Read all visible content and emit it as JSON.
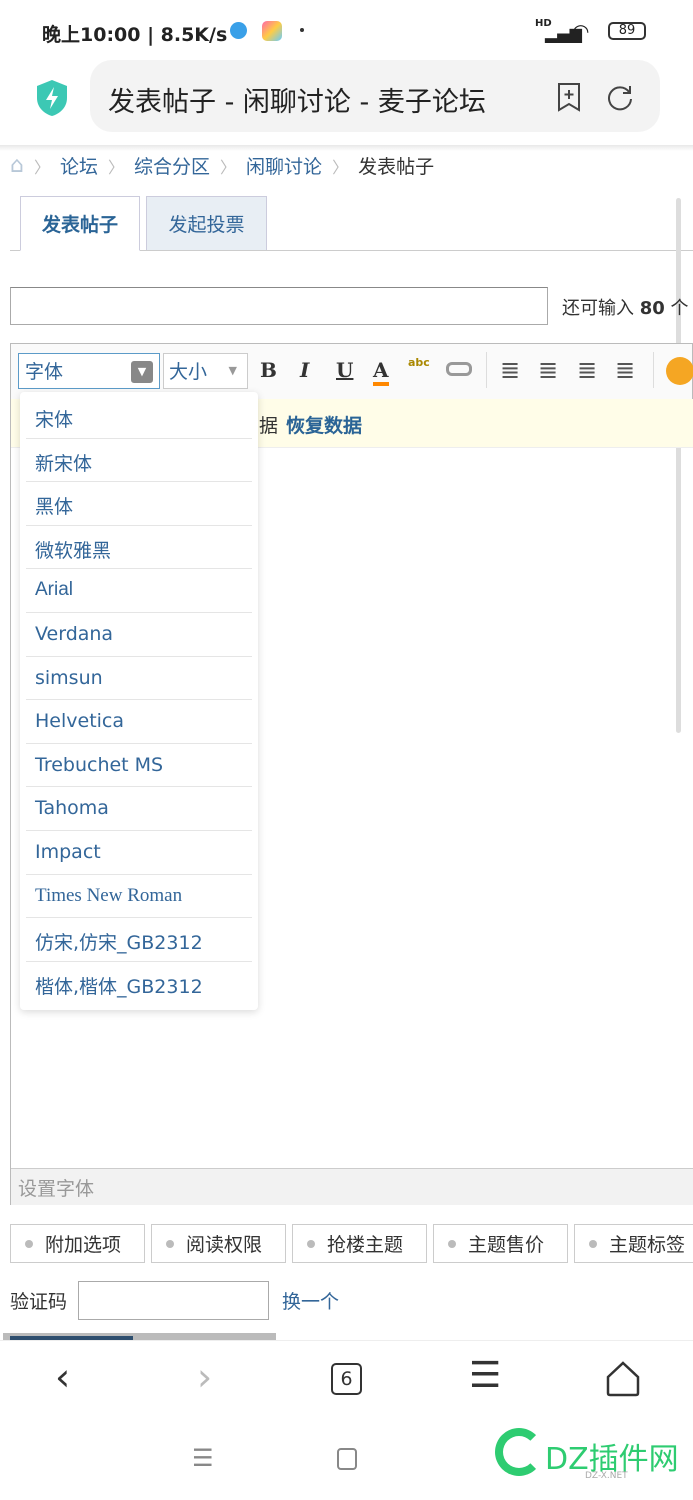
{
  "status_bar": {
    "time": "晚上10:00 | 8.5K/s",
    "battery": "89",
    "signal": "HD"
  },
  "url_bar": {
    "title": "发表帖子 - 闲聊讨论 - 麦子论坛"
  },
  "breadcrumb": [
    "论坛",
    "综合分区",
    "闲聊讨论"
  ],
  "breadcrumb_current": "发表帖子",
  "tabs": [
    {
      "label": "发表帖子",
      "active": true
    },
    {
      "label": "发起投票",
      "active": false
    }
  ],
  "subject": {
    "value": "",
    "counter_prefix": "还可输入",
    "counter_num": "80",
    "counter_suffix": "个"
  },
  "toolbar": {
    "font_label": "字体",
    "size_label": "大小",
    "bold": "B",
    "italic": "I",
    "underline": "U",
    "color": "A",
    "spell": "abc"
  },
  "notice": {
    "text": "据",
    "link": "恢复数据"
  },
  "font_options": [
    "宋体",
    "新宋体",
    "黑体",
    "微软雅黑",
    "Arial",
    "Verdana",
    "simsun",
    "Helvetica",
    "Trebuchet MS",
    "Tahoma",
    "Impact",
    "Times New Roman",
    "仿宋,仿宋_GB2312",
    "楷体,楷体_GB2312"
  ],
  "editor_status": "设置字体",
  "option_buttons": [
    "附加选项",
    "阅读权限",
    "抢楼主题",
    "主题售价",
    "主题标签"
  ],
  "captcha": {
    "label": "验证码",
    "value": "",
    "refresh": "换一个"
  },
  "browser_nav": {
    "tabs_count": "6"
  },
  "watermark": {
    "text": "DZ插件网",
    "sub": "DZ-X.NET"
  }
}
